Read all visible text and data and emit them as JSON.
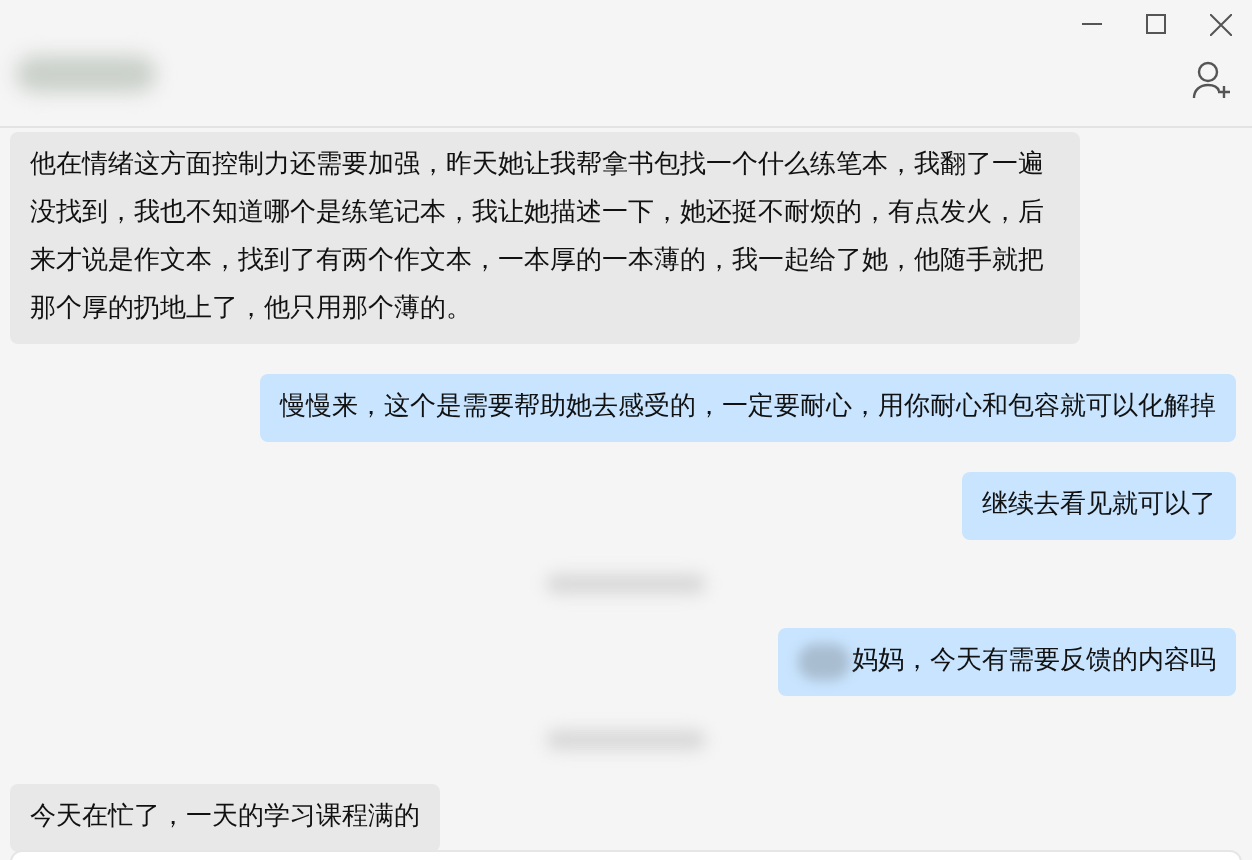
{
  "messages": [
    {
      "kind": "received",
      "text": "他在情绪这方面控制力还需要加强，昨天她让我帮拿书包找一个什么练笔本，我翻了一遍没找到，我也不知道哪个是练笔记本，我让她描述一下，她还挺不耐烦的，有点发火，后来才说是作文本，找到了有两个作文本，一本厚的一本薄的，我一起给了她，他随手就把那个厚的扔地上了，他只用那个薄的。"
    },
    {
      "kind": "sent",
      "text": "慢慢来，这个是需要帮助她去感受的，一定要耐心，用你耐心和包容就可以化解掉"
    },
    {
      "kind": "sent",
      "text": "继续去看见就可以了"
    },
    {
      "kind": "time"
    },
    {
      "kind": "sent",
      "redacted_prefix": true,
      "text": "妈妈，今天有需要反馈的内容吗"
    },
    {
      "kind": "time"
    },
    {
      "kind": "received",
      "text": "今天在忙了，一天的学习课程满的"
    }
  ]
}
